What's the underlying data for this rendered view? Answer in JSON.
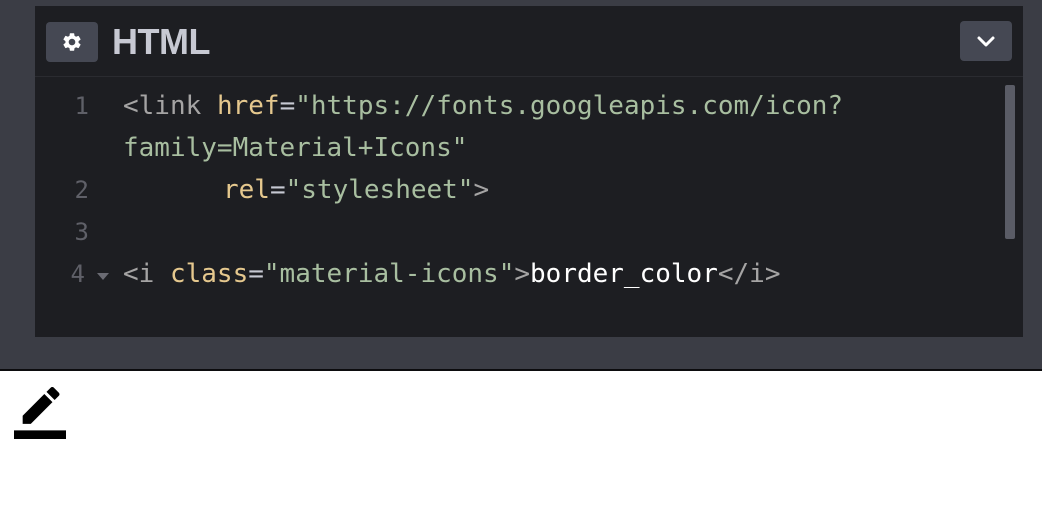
{
  "panel": {
    "title": "HTML",
    "settings_icon": "gear-icon",
    "collapse_icon": "chevron-down-icon"
  },
  "code": {
    "line_numbers": [
      "1",
      "2",
      "3",
      "4"
    ],
    "line1": {
      "open": "<link",
      "attr": "href",
      "eq": "=",
      "value_part1": "\"https://fonts.googleapis.com/icon?",
      "value_part2": "family=Material+Icons\""
    },
    "line2": {
      "attr": "rel",
      "eq": "=",
      "value": "\"stylesheet\"",
      "close": ">"
    },
    "line4": {
      "open": "<i",
      "attr": "class",
      "eq": "=",
      "value": "\"material-icons\"",
      "close": ">",
      "text": "border_color",
      "end_tag": "</i>"
    }
  },
  "output": {
    "icon": "border-color-icon",
    "icon_color": "#000000"
  },
  "colors": {
    "frame": "#3b3d45",
    "editor_bg": "#1d1e22",
    "button_bg": "#454853",
    "title": "#c7c9d3",
    "tag": "#a5a4a4",
    "attribute": "#e5c88e",
    "string": "#a8bea0"
  }
}
